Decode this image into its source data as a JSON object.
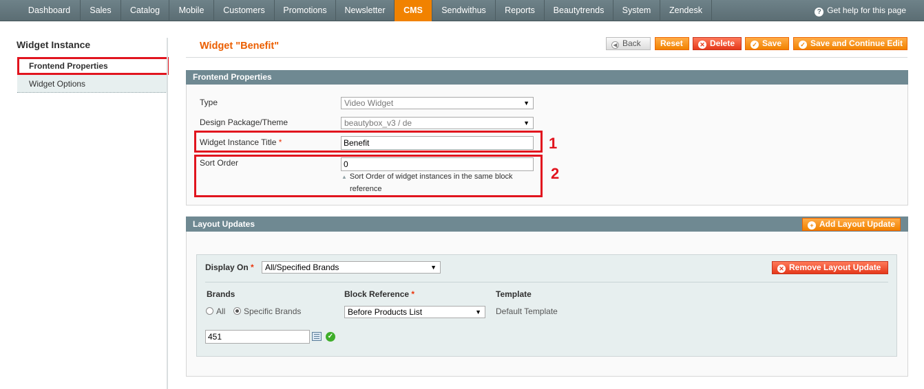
{
  "nav": {
    "items": [
      "Dashboard",
      "Sales",
      "Catalog",
      "Mobile",
      "Customers",
      "Promotions",
      "Newsletter",
      "CMS",
      "Sendwithus",
      "Reports",
      "Beautytrends",
      "System",
      "Zendesk"
    ],
    "active": "CMS",
    "help": "Get help for this page"
  },
  "sidebar": {
    "title": "Widget Instance",
    "tabs": [
      "Frontend Properties",
      "Widget Options"
    ]
  },
  "page": {
    "title": "Widget \"Benefit\"",
    "buttons": {
      "back": "Back",
      "reset": "Reset",
      "delete": "Delete",
      "save": "Save",
      "save_continue": "Save and Continue Edit"
    }
  },
  "frontend": {
    "header": "Frontend Properties",
    "type_label": "Type",
    "type_value": "Video Widget",
    "theme_label": "Design Package/Theme",
    "theme_value": "beautybox_v3 / de",
    "title_label": "Widget Instance Title",
    "title_value": "Benefit",
    "sort_label": "Sort Order",
    "sort_value": "0",
    "sort_note_1": "Sort Order of widget instances in the same block",
    "sort_note_2": "reference",
    "required_mark": "*"
  },
  "callouts": [
    "1",
    "2"
  ],
  "layout": {
    "header": "Layout Updates",
    "add_button": "Add Layout Update",
    "display_on_label": "Display On",
    "display_on_value": "All/Specified Brands",
    "remove_button": "Remove Layout Update",
    "brands_header": "Brands",
    "block_ref_header": "Block Reference",
    "template_header": "Template",
    "radio_all": "All",
    "radio_specific": "Specific Brands",
    "block_ref_value": "Before Products List",
    "template_value": "Default Template",
    "brand_ids": "451"
  },
  "colors": {
    "accent": "#f18200",
    "header_bar": "#6f8992",
    "highlight": "#e1141e"
  }
}
